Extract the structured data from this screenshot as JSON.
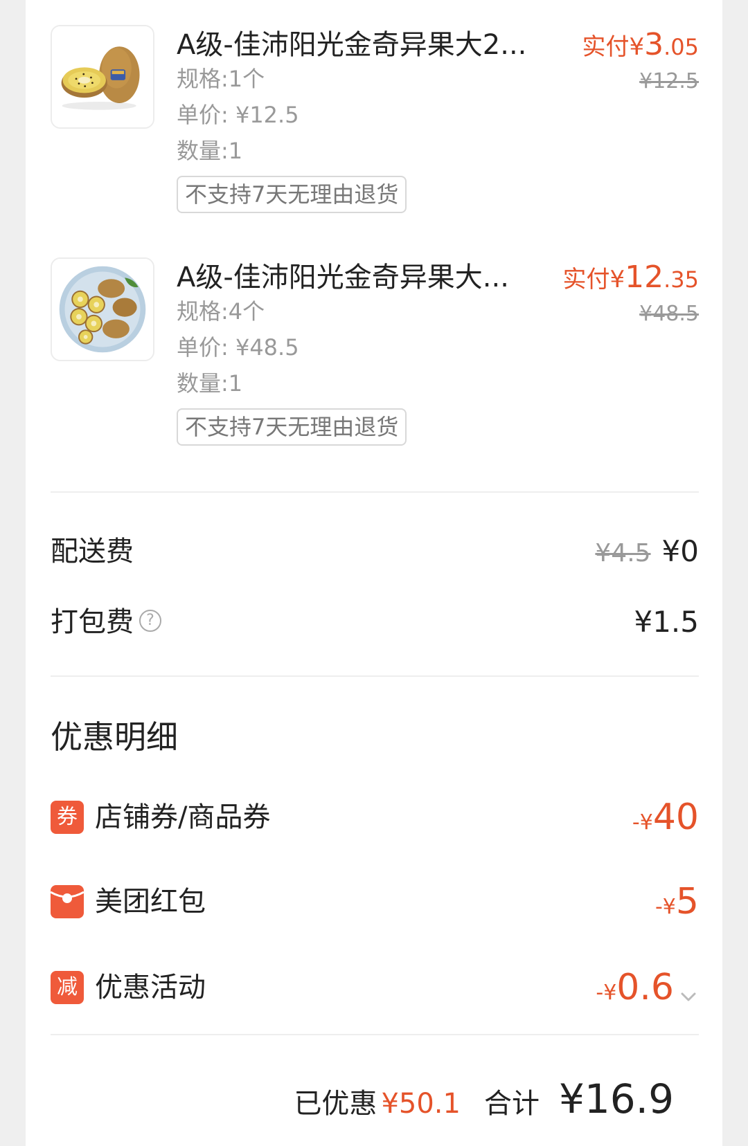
{
  "items": [
    {
      "name": "A级-佳沛阳光金奇异果大2...",
      "paid_label": "实付¥",
      "paid_int": "3",
      "paid_dec": ".05",
      "original_price": "¥12.5",
      "spec": "规格:1个",
      "unit_price": "单价: ¥12.5",
      "quantity": "数量:1",
      "tag": "不支持7天无理由退货",
      "image_icon": "kiwi-whole-and-half-icon"
    },
    {
      "name": "A级-佳沛阳光金奇异果大...",
      "paid_label": "实付¥",
      "paid_int": "12",
      "paid_dec": ".35",
      "original_price": "¥48.5",
      "spec": "规格:4个",
      "unit_price": "单价: ¥48.5",
      "quantity": "数量:1",
      "tag": "不支持7天无理由退货",
      "image_icon": "kiwi-plate-icon"
    }
  ],
  "fees": {
    "delivery": {
      "label": "配送费",
      "original": "¥4.5",
      "value": "¥0"
    },
    "packing": {
      "label": "打包费",
      "value": "¥1.5",
      "help_icon": "?"
    }
  },
  "discounts": {
    "title": "优惠明细",
    "rows": [
      {
        "icon_text": "券",
        "label": "店铺券/商品券",
        "currency": "-¥",
        "amount": "40"
      },
      {
        "icon_text": "",
        "label": "美团红包",
        "currency": "-¥",
        "amount": "5"
      },
      {
        "icon_text": "减",
        "label": "优惠活动",
        "currency": "-¥",
        "amount": "0.6"
      }
    ]
  },
  "summary": {
    "saved_label": "已优惠",
    "saved_amount": "¥50.1",
    "total_label": "合计",
    "total_amount": "¥16.9"
  },
  "colors": {
    "accent": "#e5532a",
    "icon_bg": "#ef5a3a",
    "muted": "#999999",
    "background": "#efefef"
  }
}
